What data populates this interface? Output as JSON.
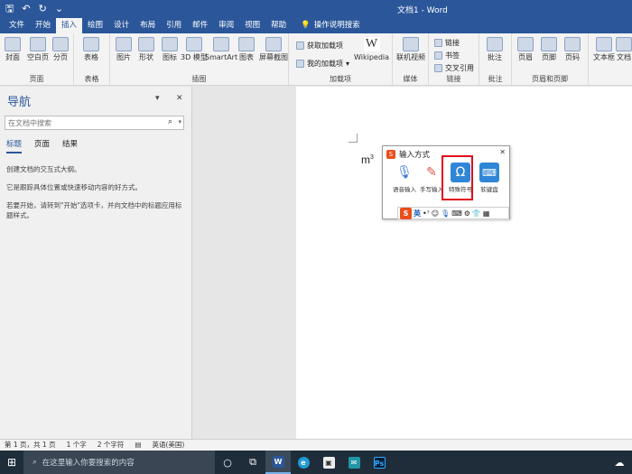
{
  "window": {
    "title": "文档1 - Word"
  },
  "qat": [
    "save-icon",
    "undo-icon",
    "redo-icon",
    "customize-icon"
  ],
  "tabs": [
    "文件",
    "开始",
    "插入",
    "绘图",
    "设计",
    "布局",
    "引用",
    "邮件",
    "审阅",
    "视图",
    "帮助"
  ],
  "active_tab": "插入",
  "tell_me": "操作说明搜索",
  "ribbon": {
    "pages": {
      "name": "页面",
      "buttons": [
        "封面",
        "空白页",
        "分页"
      ]
    },
    "tables": {
      "name": "表格",
      "buttons": [
        "表格"
      ]
    },
    "illustrations": {
      "name": "插图",
      "buttons": [
        "图片",
        "形状",
        "图标",
        "3D 模型",
        "SmartArt",
        "图表",
        "屏幕截图"
      ]
    },
    "addins": {
      "name": "加载项",
      "get": "获取加载项",
      "my": "我的加载项",
      "wiki": "Wikipedia"
    },
    "media": {
      "name": "媒体",
      "video": "联机视频"
    },
    "links": {
      "name": "链接",
      "items": [
        "链接",
        "书签",
        "交叉引用"
      ]
    },
    "comments": {
      "name": "批注",
      "comment": "批注"
    },
    "headerfooter": {
      "name": "页眉和页脚",
      "buttons": [
        "页眉",
        "页脚",
        "页码"
      ]
    },
    "text": {
      "buttons": [
        "文本框",
        "文档"
      ]
    }
  },
  "nav": {
    "title": "导航",
    "search_placeholder": "在文档中搜索",
    "tabs": [
      "标题",
      "页面",
      "结果"
    ],
    "para1": "创建文档的交互式大纲。",
    "para2": "它是跟踪具体位置或快速移动内容的好方式。",
    "para3": "若要开始，请转到\"开始\"选项卡，并向文档中的标题应用标题样式。"
  },
  "document": {
    "text": "m",
    "superscript": "3"
  },
  "ime": {
    "title": "输入方式",
    "items": [
      "语音输入",
      "手写输入",
      "特殊符号",
      "软键盘"
    ],
    "bar_label": "英"
  },
  "status": [
    "第 1 页，共 1 页",
    "1 个字",
    "2 个字符",
    "英语(美国)"
  ],
  "taskbar": {
    "search_placeholder": "在这里输入你要搜索的内容"
  },
  "colors": {
    "accent": "#2b579a",
    "highlight": "#e10d1c"
  }
}
